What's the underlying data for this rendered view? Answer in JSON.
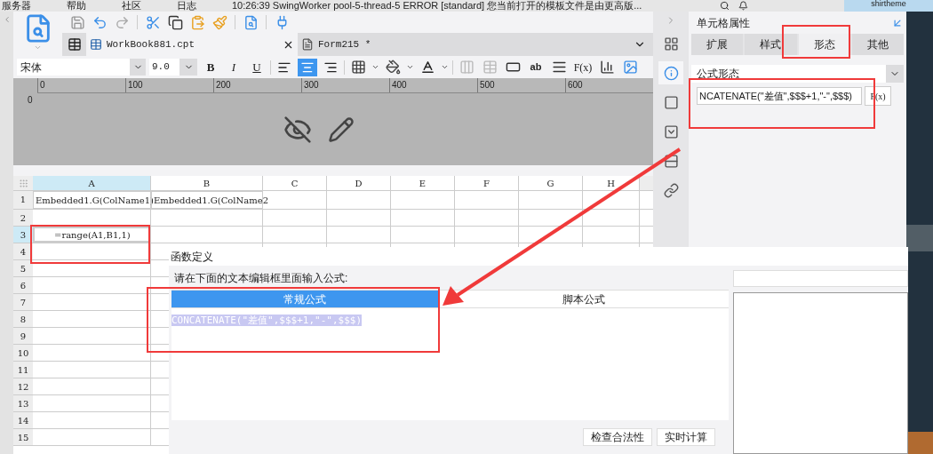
{
  "menu_bar": {
    "items": [
      "服务器",
      "帮助",
      "社区"
    ],
    "log_label": "日志",
    "log": "10:26:39 SwingWorker pool-5-thread-5 ERROR [standard] 您当前打开的模板文件是由更高版...",
    "user": "shirtheme"
  },
  "tabs": [
    {
      "label": "WorkBook881.cpt",
      "selected": true,
      "kind": "workbook"
    },
    {
      "label": "Form215 *",
      "selected": false,
      "kind": "form"
    }
  ],
  "format_bar": {
    "font": "宋体",
    "size": "9.0",
    "style_buttons": [
      "B",
      "I",
      "U"
    ],
    "align": [
      {
        "kind": "left",
        "selected": false
      },
      {
        "kind": "center",
        "selected": true
      },
      {
        "kind": "right",
        "selected": false
      }
    ],
    "text_label": "ab",
    "formula_label": "F(x)"
  },
  "ruler": {
    "marks": [
      "0",
      "100",
      "200",
      "300",
      "400",
      "500",
      "600"
    ],
    "vertical": "0"
  },
  "sheet": {
    "columns": [
      {
        "label": "A",
        "selected": true
      },
      {
        "label": "B",
        "selected": false
      },
      {
        "label": "C",
        "selected": false
      },
      {
        "label": "D",
        "selected": false
      },
      {
        "label": "E",
        "selected": false
      },
      {
        "label": "F",
        "selected": false
      },
      {
        "label": "G",
        "selected": false
      },
      {
        "label": "H",
        "selected": false
      }
    ],
    "rows": [
      {
        "label": "1",
        "selected": false,
        "cells": [
          "Embedded1.G(ColName1)",
          "Embedded1.G(ColName2"
        ]
      },
      {
        "label": "2",
        "selected": false
      },
      {
        "label": "3",
        "selected": true,
        "cells": [
          "=range(A1,B1,1)"
        ]
      },
      {
        "label": "4",
        "selected": false
      },
      {
        "label": "5",
        "selected": false
      },
      {
        "label": "6",
        "selected": false
      },
      {
        "label": "7",
        "selected": false
      },
      {
        "label": "8",
        "selected": false
      },
      {
        "label": "9",
        "selected": false
      },
      {
        "label": "10",
        "selected": false
      },
      {
        "label": "11",
        "selected": false
      },
      {
        "label": "12",
        "selected": false
      },
      {
        "label": "13",
        "selected": false
      },
      {
        "label": "14",
        "selected": false
      },
      {
        "label": "15",
        "selected": false
      }
    ]
  },
  "side_icons": [
    {
      "kind": "layout",
      "selected": false
    },
    {
      "kind": "cell-info",
      "selected": true
    },
    {
      "kind": "frame",
      "selected": false
    },
    {
      "kind": "widget",
      "selected": false
    },
    {
      "kind": "condition",
      "selected": false
    },
    {
      "kind": "link",
      "selected": false
    }
  ],
  "panel": {
    "title": "单元格属性",
    "tabs": [
      {
        "label": "扩展",
        "selected": false
      },
      {
        "label": "样式",
        "selected": false
      },
      {
        "label": "形态",
        "selected": true
      },
      {
        "label": "其他",
        "selected": false
      }
    ],
    "dropdown": "公式形态",
    "formula": "NCATENATE(\"差值\",$$$+1,\"-\",$$$)",
    "fx_button": "F(x)"
  },
  "dialog": {
    "title": "函数定义",
    "prompt": "请在下面的文本编辑框里面输入公式:",
    "tabs": [
      {
        "label": "常规公式",
        "selected": true
      },
      {
        "label": "脚本公式",
        "selected": false
      }
    ],
    "formula": "CONCATENATE(\"差值\",$$$+1,\"-\",$$$)",
    "buttons": [
      "检查合法性",
      "实时计算"
    ]
  }
}
